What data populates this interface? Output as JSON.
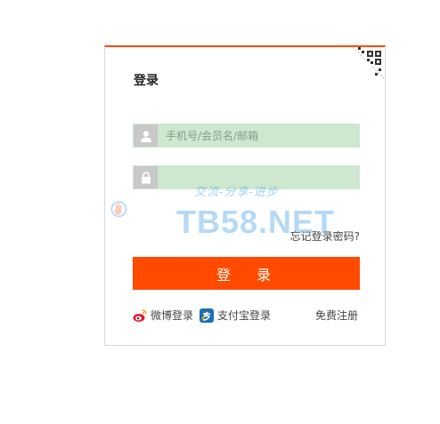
{
  "login": {
    "title": "登录",
    "account_placeholder": "手机号/会员名/邮箱",
    "password_placeholder": "",
    "forgot_label": "忘记登录密码?",
    "submit_label": "登 录",
    "weibo_label": "微博登录",
    "alipay_label": "支付宝登录",
    "register_label": "免费注册"
  },
  "watermark": {
    "brand": "TB58.NET",
    "slogan": "交流-分享-进步"
  },
  "colors": {
    "accent": "#ff4a00",
    "field_bg": "#cde8cf",
    "icon_bg": "#c9c9c9"
  },
  "icons": [
    "qrcode-icon",
    "user-icon",
    "lock-icon",
    "weibo-icon",
    "alipay-icon"
  ]
}
